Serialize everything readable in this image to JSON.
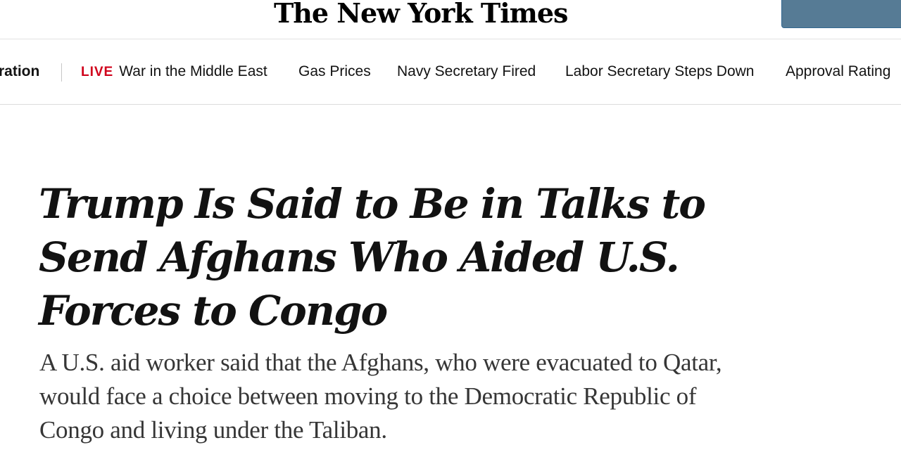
{
  "masthead": {
    "logo_text": "The New York Times"
  },
  "nav": {
    "items": [
      {
        "label": "ration",
        "bold": true
      },
      {
        "live_label": "LIVE",
        "label": "War in the Middle East"
      },
      {
        "label": "Gas Prices"
      },
      {
        "label": "Navy Secretary Fired"
      },
      {
        "label": "Labor Secretary Steps Down"
      },
      {
        "label": "Approval Rating"
      }
    ]
  },
  "article": {
    "headline": "Trump Is Said to Be in Talks to Send Afghans Who Aided U.S. Forces to Congo",
    "summary": "A U.S. aid worker said that the Afghans, who were evacuated to Qatar, would face a choice between moving to the Democratic Republic of Congo and living under the Taliban."
  },
  "colors": {
    "live": "#d0021b",
    "account_button": "#567b95"
  }
}
